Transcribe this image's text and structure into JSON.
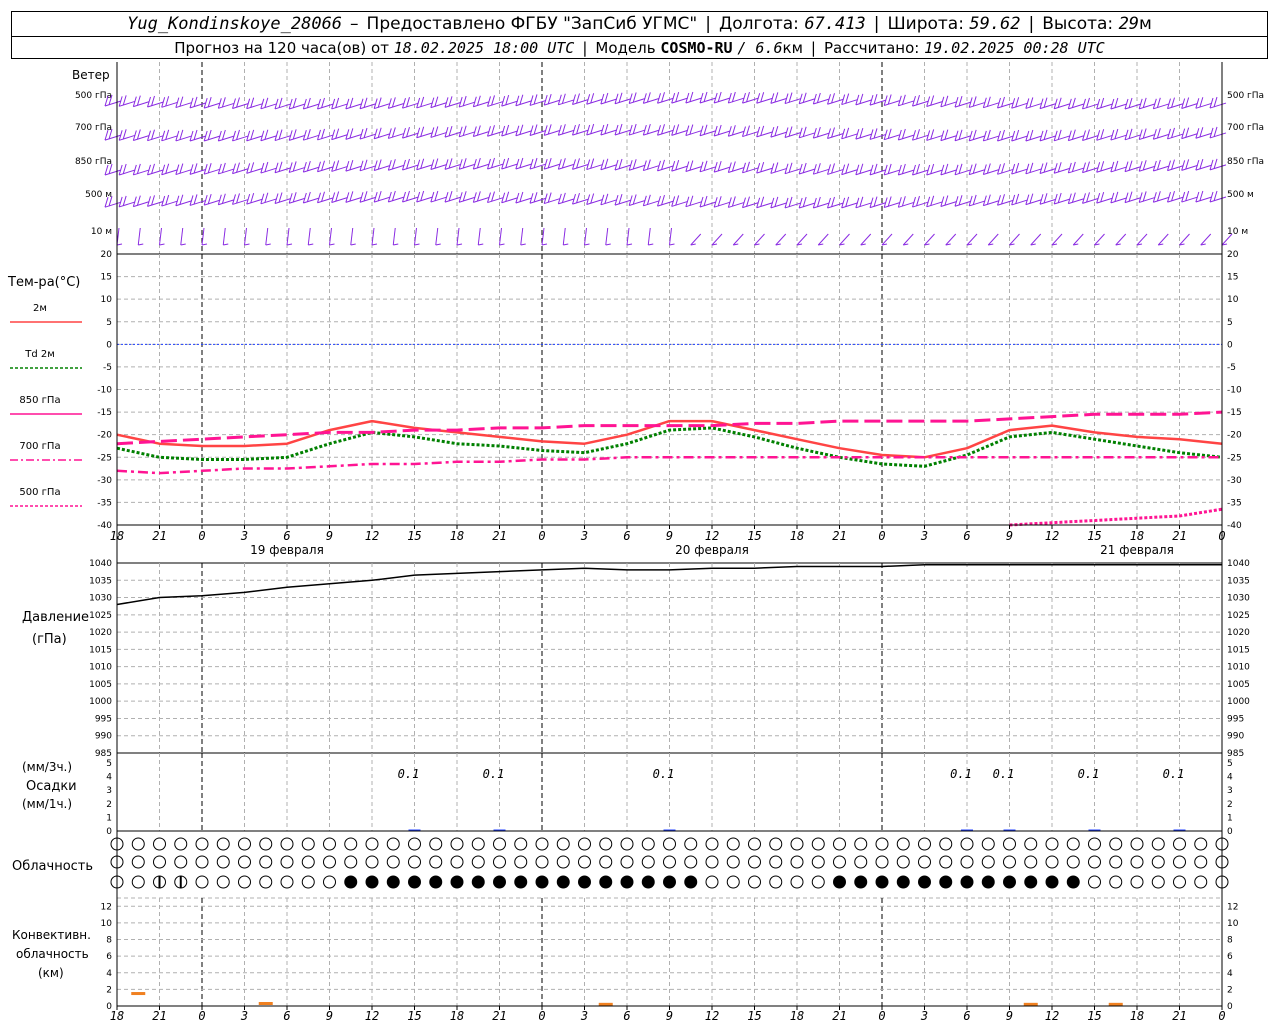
{
  "header": {
    "station": "Yug_Kondinskoye_28066",
    "dash": "–",
    "provider": "Предоставлено ФГБУ \"ЗапСиб УГМС\"",
    "lon_label": "Долгота:",
    "lon": "67.413",
    "lat_label": "Широта:",
    "lat": "59.62",
    "alt_label": "Высота:",
    "alt": "29",
    "alt_unit": "м",
    "fc_label": "Прогноз на 120 часа(ов) от",
    "fc_start": "18.02.2025 18:00 UTC",
    "model_label": "Модель",
    "model": "COSMO-RU",
    "resolution": "/ 6.6",
    "res_unit": "км",
    "calc_label": "Рассчитано:",
    "calc_time": "19.02.2025 00:28 UTC"
  },
  "wind_panel": {
    "title": "Ветер",
    "levels": [
      "500 гПа",
      "700 гПа",
      "850 гПа",
      "500 м",
      "10  м"
    ],
    "barb_color": "#8a2be2"
  },
  "temp_panel": {
    "title": "Тем-ра(°С)",
    "legend": [
      "2м",
      "Td  2м",
      "850 гПа",
      "700 гПа",
      "500 гПа"
    ],
    "ticks": [
      "20",
      "15",
      "10",
      "5",
      "0",
      "-5",
      "-10",
      "-15",
      "-20",
      "-25",
      "-30",
      "-35",
      "-40"
    ]
  },
  "pressure_panel": {
    "title": "Давление",
    "unit": "(гПа)",
    "ticks": [
      "1040",
      "1035",
      "1030",
      "1025",
      "1020",
      "1015",
      "1010",
      "1005",
      "1000",
      "995",
      "990",
      "985"
    ]
  },
  "precip_panel": {
    "unit3": "(мм/3ч.)",
    "title": "Осадки",
    "unit1": "(мм/1ч.)",
    "ticks": [
      "5",
      "4",
      "3",
      "2",
      "1",
      "0"
    ],
    "labels": [
      {
        "hour": 21,
        "text": "0.1"
      },
      {
        "hour": 27,
        "text": "0.1"
      },
      {
        "hour": 39,
        "text": "0.1"
      },
      {
        "hour": 60,
        "text": "0.1"
      },
      {
        "hour": 63,
        "text": "0.1"
      },
      {
        "hour": 69,
        "text": "0.1"
      },
      {
        "hour": 75,
        "text": "0.1"
      }
    ]
  },
  "cloud_panel": {
    "title": "Облачность"
  },
  "conv_panel": {
    "title1": "Конвективн.",
    "title2": "облачность",
    "unit": "(км)",
    "ticks": [
      "12",
      "10",
      "8",
      "6",
      "4",
      "2",
      "0"
    ]
  },
  "time_axis": {
    "tick_labels": [
      "18",
      "21",
      "0",
      "3",
      "6",
      "9",
      "12",
      "15",
      "18",
      "21",
      "0",
      "3",
      "6",
      "9",
      "12",
      "15",
      "18",
      "21",
      "0",
      "3",
      "6",
      "9",
      "12",
      "15",
      "18",
      "21",
      "0"
    ],
    "dates": [
      "19 февраля",
      "20 февраля",
      "21 февраля"
    ]
  },
  "chart_data": {
    "type": "line",
    "x_unit": "hours since 18.02.2025 18:00 UTC",
    "x": [
      0,
      3,
      6,
      9,
      12,
      15,
      18,
      21,
      24,
      27,
      30,
      33,
      36,
      39,
      42,
      45,
      48,
      51,
      54,
      57,
      60,
      63,
      66,
      69,
      72,
      75,
      78
    ],
    "temperature": {
      "ylim": [
        -40,
        20
      ],
      "series": [
        {
          "name": "2м",
          "color": "#ff4444",
          "values": [
            -20,
            -22,
            -22.5,
            -22.5,
            -22,
            -19,
            -17,
            -18.5,
            -19.5,
            -20.5,
            -21.5,
            -22,
            -20,
            -17,
            -17,
            -19,
            -21,
            -23,
            -24.5,
            -25,
            -23,
            -19,
            -18,
            -19.5,
            -20.5,
            -21,
            -22
          ]
        },
        {
          "name": "Td 2м",
          "color": "#008000",
          "values": [
            -23,
            -25,
            -25.5,
            -25.5,
            -25,
            -22,
            -19.5,
            -20.5,
            -22,
            -22.5,
            -23.5,
            -24,
            -22,
            -19,
            -18.5,
            -20.5,
            -23,
            -25,
            -26.5,
            -27,
            -24.5,
            -20.5,
            -19.5,
            -21,
            -22.5,
            -24,
            -25
          ]
        },
        {
          "name": "850 гПа",
          "color": "#ff1493",
          "values": [
            -22,
            -21.5,
            -21,
            -20.5,
            -20,
            -19.5,
            -19.5,
            -19,
            -19,
            -18.5,
            -18.5,
            -18,
            -18,
            -18,
            -18,
            -17.5,
            -17.5,
            -17,
            -17,
            -17,
            -17,
            -16.5,
            -16,
            -15.5,
            -15.5,
            -15.5,
            -15
          ]
        },
        {
          "name": "700 гПа",
          "color": "#ff1493",
          "values": [
            -28,
            -28.5,
            -28,
            -27.5,
            -27.5,
            -27,
            -26.5,
            -26.5,
            -26,
            -26,
            -25.5,
            -25.5,
            -25,
            -25,
            -25,
            -25,
            -25,
            -25,
            -25,
            -25,
            -25,
            -25,
            -25,
            -25,
            -25,
            -25,
            -25
          ]
        },
        {
          "name": "500 гПа",
          "color": "#ff1493",
          "values": [
            null,
            null,
            null,
            null,
            null,
            null,
            null,
            null,
            null,
            null,
            null,
            null,
            null,
            null,
            null,
            null,
            null,
            null,
            null,
            null,
            null,
            -40,
            -39.5,
            -39,
            -38.5,
            -38,
            -36.5
          ]
        }
      ]
    },
    "pressure": {
      "ylim": [
        985,
        1040
      ],
      "values": [
        1028,
        1030,
        1030.5,
        1031.5,
        1033,
        1034,
        1035,
        1036.5,
        1037,
        1037.5,
        1038,
        1038.5,
        1038,
        1038,
        1038.5,
        1038.5,
        1039,
        1039,
        1039,
        1039.5,
        1039.5,
        1039.5,
        1039.5,
        1039.5,
        1039.5,
        1039.5,
        1039.5
      ]
    },
    "cloud_low_overcast_hours": [
      16.5,
      69
    ],
    "convective_cloud_km": [
      {
        "hour": 1.5,
        "value": 1.5
      },
      {
        "hour": 10.5,
        "value": 0.3
      },
      {
        "hour": 34.5,
        "value": 0.2
      },
      {
        "hour": 64.5,
        "value": 0.2
      },
      {
        "hour": 70.5,
        "value": 0.2
      }
    ]
  }
}
